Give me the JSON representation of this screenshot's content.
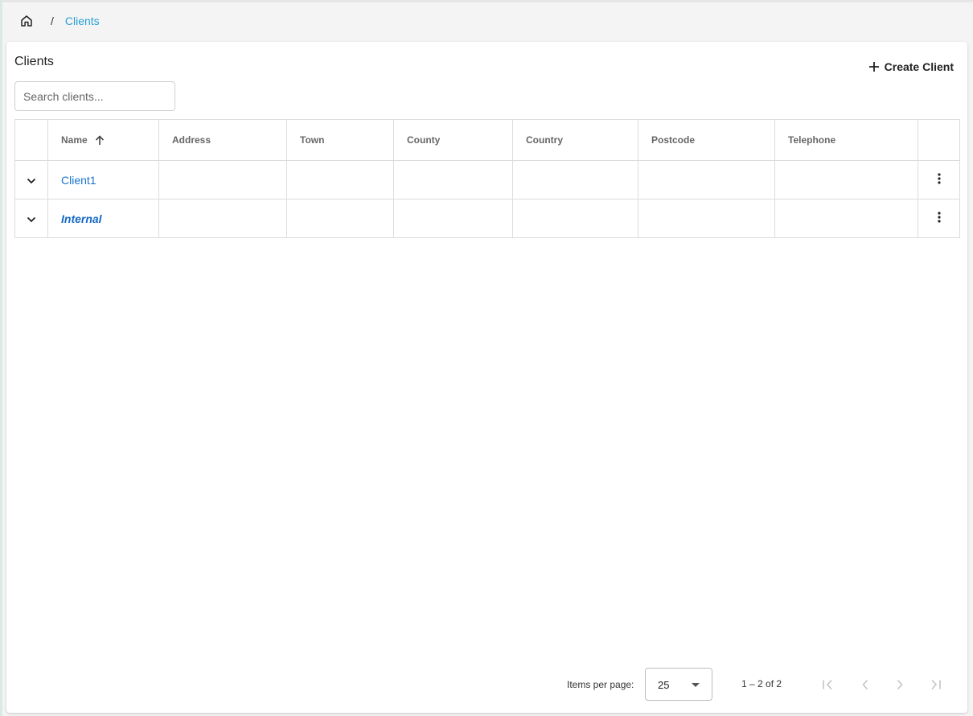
{
  "breadcrumb": {
    "home_icon": "home-icon",
    "separator": "/",
    "current": "Clients"
  },
  "page": {
    "title": "Clients",
    "create_label": "Create Client"
  },
  "search": {
    "placeholder": "Search clients..."
  },
  "table": {
    "columns": [
      "Name",
      "Address",
      "Town",
      "County",
      "Country",
      "Postcode",
      "Telephone"
    ],
    "sort": {
      "column": "Name",
      "direction": "ascending"
    },
    "rows": [
      {
        "name": "Client1",
        "address": "",
        "town": "",
        "county": "",
        "country": "",
        "postcode": "",
        "telephone": ""
      },
      {
        "name": "Internal",
        "address": "",
        "town": "",
        "county": "",
        "country": "",
        "postcode": "",
        "telephone": ""
      }
    ]
  },
  "paginator": {
    "items_per_page_label": "Items per page:",
    "items_per_page": "25",
    "range_label": "1 – 2 of 2"
  },
  "colors": {
    "link": "#1a73c8",
    "breadcrumb_active": "#2aa0d8",
    "disabled_icon": "#c4c4c4"
  }
}
